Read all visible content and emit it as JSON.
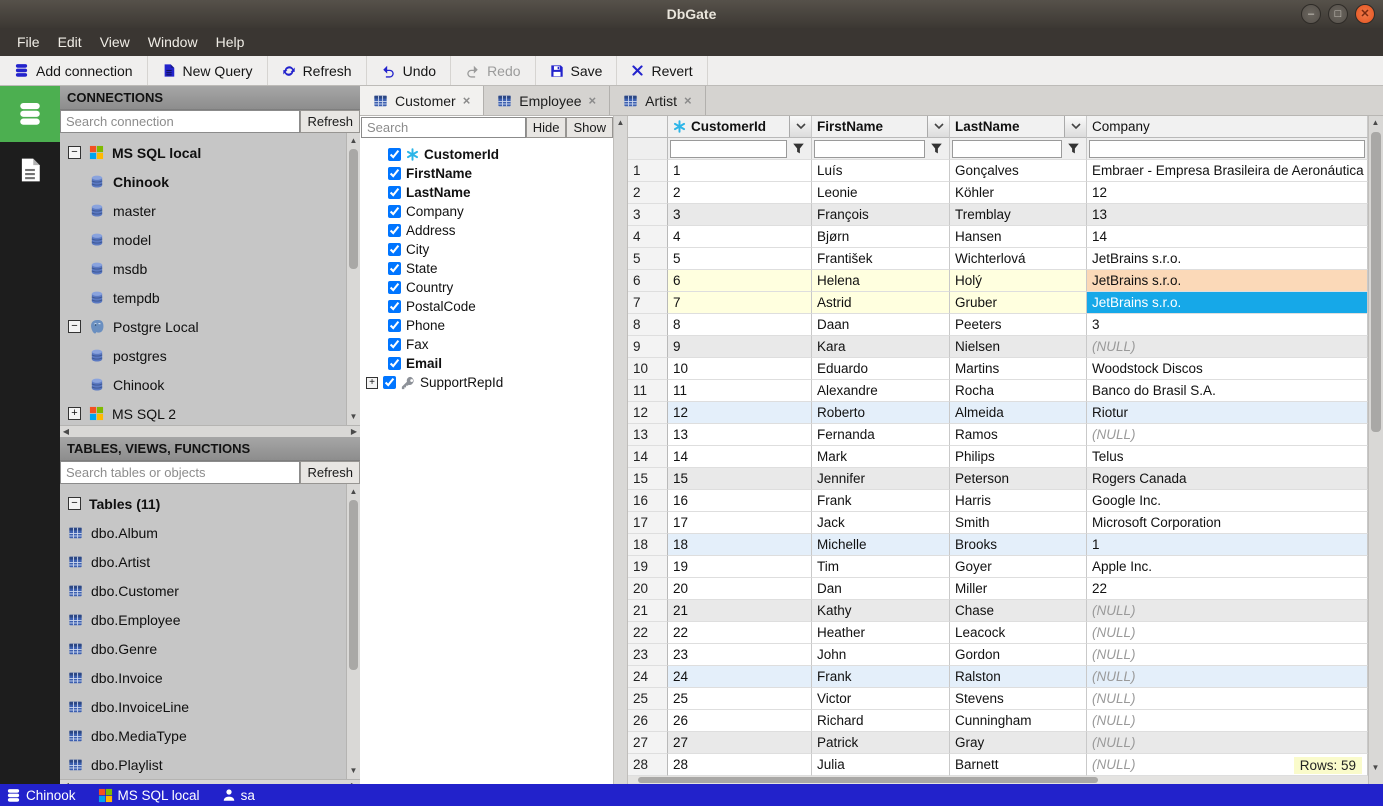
{
  "window": {
    "title": "DbGate"
  },
  "menubar": {
    "items": [
      "File",
      "Edit",
      "View",
      "Window",
      "Help"
    ]
  },
  "toolbar": {
    "buttons": [
      {
        "label": "Add connection",
        "icon": "db-stack",
        "disabled": false
      },
      {
        "label": "New Query",
        "icon": "file",
        "disabled": false
      },
      {
        "label": "Refresh",
        "icon": "refresh",
        "disabled": false
      },
      {
        "label": "Undo",
        "icon": "undo",
        "disabled": false
      },
      {
        "label": "Redo",
        "icon": "redo",
        "disabled": true
      },
      {
        "label": "Save",
        "icon": "save",
        "disabled": false
      },
      {
        "label": "Revert",
        "icon": "revert",
        "disabled": false
      }
    ]
  },
  "rail": {
    "items": [
      {
        "icon": "db-stack",
        "active": true
      },
      {
        "icon": "file",
        "active": false
      }
    ]
  },
  "connections_panel": {
    "title": "CONNECTIONS",
    "search_placeholder": "Search connection",
    "refresh_label": "Refresh",
    "items": [
      {
        "label": "MS SQL local",
        "icon": "mssql",
        "expander": "minus",
        "bold": true
      },
      {
        "label": "Chinook",
        "icon": "db",
        "bold": true
      },
      {
        "label": "master",
        "icon": "db"
      },
      {
        "label": "model",
        "icon": "db"
      },
      {
        "label": "msdb",
        "icon": "db"
      },
      {
        "label": "tempdb",
        "icon": "db"
      },
      {
        "label": "Postgre Local",
        "icon": "postgres",
        "expander": "minus"
      },
      {
        "label": "postgres",
        "icon": "db"
      },
      {
        "label": "Chinook",
        "icon": "db"
      },
      {
        "label": "MS SQL 2",
        "icon": "mssql",
        "expander": "plus"
      }
    ]
  },
  "tables_panel": {
    "title": "TABLES, VIEWS, FUNCTIONS",
    "search_placeholder": "Search tables or objects",
    "refresh_label": "Refresh",
    "group_label": "Tables (11)",
    "items": [
      "dbo.Album",
      "dbo.Artist",
      "dbo.Customer",
      "dbo.Employee",
      "dbo.Genre",
      "dbo.Invoice",
      "dbo.InvoiceLine",
      "dbo.MediaType",
      "dbo.Playlist"
    ]
  },
  "tabs": [
    {
      "label": "Customer",
      "active": true
    },
    {
      "label": "Employee",
      "active": false
    },
    {
      "label": "Artist",
      "active": false
    }
  ],
  "column_manager": {
    "search_placeholder": "Search",
    "hide_label": "Hide",
    "show_label": "Show",
    "columns": [
      {
        "name": "CustomerId",
        "bold": true,
        "icon": "pk",
        "checked": true
      },
      {
        "name": "FirstName",
        "bold": true,
        "checked": true
      },
      {
        "name": "LastName",
        "bold": true,
        "checked": true
      },
      {
        "name": "Company",
        "checked": true
      },
      {
        "name": "Address",
        "checked": true
      },
      {
        "name": "City",
        "checked": true
      },
      {
        "name": "State",
        "checked": true
      },
      {
        "name": "Country",
        "checked": true
      },
      {
        "name": "PostalCode",
        "checked": true
      },
      {
        "name": "Phone",
        "checked": true
      },
      {
        "name": "Fax",
        "checked": true
      },
      {
        "name": "Email",
        "bold": true,
        "checked": true
      },
      {
        "name": "SupportRepId",
        "icon": "key",
        "expander": "plus",
        "checked": true
      }
    ]
  },
  "grid": {
    "columns": [
      {
        "name": "CustomerId",
        "icon": "pk",
        "bold": true,
        "cls": "w-id",
        "dropdown": true,
        "filter": true
      },
      {
        "name": "FirstName",
        "bold": true,
        "cls": "w-fn",
        "dropdown": true,
        "filter": true
      },
      {
        "name": "LastName",
        "bold": true,
        "cls": "w-ln",
        "dropdown": true,
        "filter": true
      },
      {
        "name": "Company",
        "cls": "last",
        "dropdown": false,
        "filter": false
      }
    ],
    "null_text": "(NULL)",
    "rows_badge": "Rows: 59",
    "rows": [
      {
        "n": "1",
        "c": [
          "1",
          "Luís",
          "Gonçalves",
          "Embraer - Empresa Brasileira de Aeronáutica"
        ],
        "bg": "",
        "cc": ""
      },
      {
        "n": "2",
        "c": [
          "2",
          "Leonie",
          "Köhler",
          "12"
        ],
        "bg": "",
        "cc": ""
      },
      {
        "n": "3",
        "c": [
          "3",
          "François",
          "Tremblay",
          "13"
        ],
        "bg": "gray",
        "cc": ""
      },
      {
        "n": "4",
        "c": [
          "4",
          "Bjørn",
          "Hansen",
          "14"
        ],
        "bg": "",
        "cc": ""
      },
      {
        "n": "5",
        "c": [
          "5",
          "František",
          "Wichterlová",
          "JetBrains s.r.o."
        ],
        "bg": "",
        "cc": ""
      },
      {
        "n": "6",
        "c": [
          "6",
          "Helena",
          "Holý",
          "JetBrains s.r.o."
        ],
        "bg": "modified",
        "cc": "modified"
      },
      {
        "n": "7",
        "c": [
          "7",
          "Astrid",
          "Gruber",
          "JetBrains s.r.o."
        ],
        "bg": "modified",
        "cc": "selected"
      },
      {
        "n": "8",
        "c": [
          "8",
          "Daan",
          "Peeters",
          "3"
        ],
        "bg": "",
        "cc": ""
      },
      {
        "n": "9",
        "c": [
          "9",
          "Kara",
          "Nielsen",
          null
        ],
        "bg": "gray",
        "cc": ""
      },
      {
        "n": "10",
        "c": [
          "10",
          "Eduardo",
          "Martins",
          "Woodstock Discos"
        ],
        "bg": "",
        "cc": ""
      },
      {
        "n": "11",
        "c": [
          "11",
          "Alexandre",
          "Rocha",
          "Banco do Brasil S.A."
        ],
        "bg": "",
        "cc": ""
      },
      {
        "n": "12",
        "c": [
          "12",
          "Roberto",
          "Almeida",
          "Riotur"
        ],
        "bg": "blue",
        "cc": ""
      },
      {
        "n": "13",
        "c": [
          "13",
          "Fernanda",
          "Ramos",
          null
        ],
        "bg": "",
        "cc": ""
      },
      {
        "n": "14",
        "c": [
          "14",
          "Mark",
          "Philips",
          "Telus"
        ],
        "bg": "",
        "cc": ""
      },
      {
        "n": "15",
        "c": [
          "15",
          "Jennifer",
          "Peterson",
          "Rogers Canada"
        ],
        "bg": "gray",
        "cc": ""
      },
      {
        "n": "16",
        "c": [
          "16",
          "Frank",
          "Harris",
          "Google Inc."
        ],
        "bg": "",
        "cc": ""
      },
      {
        "n": "17",
        "c": [
          "17",
          "Jack",
          "Smith",
          "Microsoft Corporation"
        ],
        "bg": "",
        "cc": ""
      },
      {
        "n": "18",
        "c": [
          "18",
          "Michelle",
          "Brooks",
          "1"
        ],
        "bg": "blue",
        "cc": ""
      },
      {
        "n": "19",
        "c": [
          "19",
          "Tim",
          "Goyer",
          "Apple Inc."
        ],
        "bg": "",
        "cc": ""
      },
      {
        "n": "20",
        "c": [
          "20",
          "Dan",
          "Miller",
          "22"
        ],
        "bg": "",
        "cc": ""
      },
      {
        "n": "21",
        "c": [
          "21",
          "Kathy",
          "Chase",
          null
        ],
        "bg": "gray",
        "cc": ""
      },
      {
        "n": "22",
        "c": [
          "22",
          "Heather",
          "Leacock",
          null
        ],
        "bg": "",
        "cc": ""
      },
      {
        "n": "23",
        "c": [
          "23",
          "John",
          "Gordon",
          null
        ],
        "bg": "",
        "cc": ""
      },
      {
        "n": "24",
        "c": [
          "24",
          "Frank",
          "Ralston",
          null
        ],
        "bg": "blue",
        "cc": ""
      },
      {
        "n": "25",
        "c": [
          "25",
          "Victor",
          "Stevens",
          null
        ],
        "bg": "",
        "cc": ""
      },
      {
        "n": "26",
        "c": [
          "26",
          "Richard",
          "Cunningham",
          null
        ],
        "bg": "",
        "cc": ""
      },
      {
        "n": "27",
        "c": [
          "27",
          "Patrick",
          "Gray",
          null
        ],
        "bg": "gray",
        "cc": ""
      },
      {
        "n": "28",
        "c": [
          "28",
          "Julia",
          "Barnett",
          null
        ],
        "bg": "",
        "cc": ""
      }
    ]
  },
  "statusbar": {
    "items": [
      {
        "label": "Chinook",
        "icon": "db-stack"
      },
      {
        "label": "MS SQL local",
        "icon": "mssql"
      },
      {
        "label": "sa",
        "icon": "user"
      }
    ]
  },
  "colors": {
    "accent_blue": "#2222cc",
    "rail_green": "#4caf50",
    "status_bg": "#2222cb",
    "selected_cell": "#16a8e8",
    "modified_row": "#ffffdf",
    "modified_cell": "#fbd9b8",
    "shaded_row_gray": "#e9e9e9",
    "shaded_row_blue": "#e4effa"
  }
}
